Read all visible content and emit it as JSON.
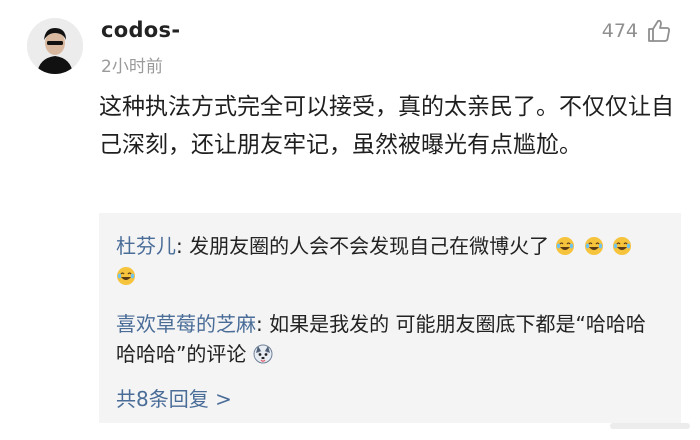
{
  "comment": {
    "username": "codos-",
    "time": "2小时前",
    "like_count": "474",
    "body": "这种执法方式完全可以接受，真的太亲民了。不仅仅让自己深刻，还让朋友牢记，虽然被曝光有点尴尬。"
  },
  "replies": [
    {
      "author": "杜芬儿",
      "separator": ": ",
      "text": "发朋友圈的人会不会发现自己在微博火了",
      "emoji": [
        "laugh-cry-emoji",
        "laugh-cry-emoji",
        "laugh-cry-emoji",
        "laugh-cry-emoji"
      ]
    },
    {
      "author": "喜欢草莓的芝麻",
      "separator": ": ",
      "text": "如果是我发的 可能朋友圈底下都是“哈哈哈哈哈哈”的评论",
      "emoji": [
        "husky-emoji"
      ]
    }
  ],
  "more_replies_label": "共8条回复 >",
  "colors": {
    "link_blue": "#4a6d98",
    "reply_background": "#f4f4f5",
    "timestamp_gray": "#9a9a9a"
  }
}
